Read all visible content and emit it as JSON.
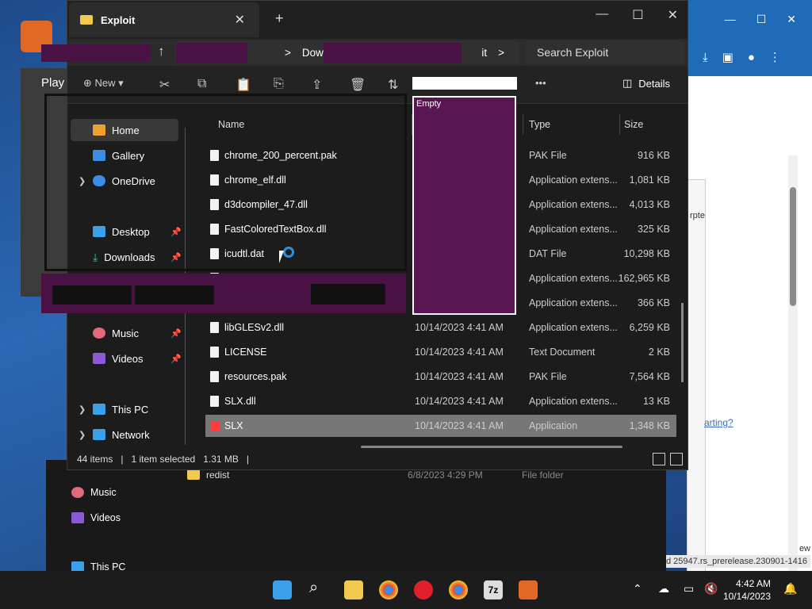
{
  "window": {
    "tab_title": "Exploit",
    "new_tab": "+",
    "minimize": "—",
    "maximize": "☐",
    "close": "✕",
    "tab_close": "✕"
  },
  "nav": {
    "back": "←",
    "forward": "→",
    "up": "↑",
    "address_parts": [
      ">",
      "Downloa",
      "it",
      ">"
    ],
    "search_placeholder": "Search Exploit"
  },
  "toolbar": {
    "new_label": "New",
    "more": "•••",
    "details_label": "Details"
  },
  "sidebar": {
    "items": [
      {
        "label": "Home",
        "active": true
      },
      {
        "label": "Gallery"
      },
      {
        "label": "OneDrive",
        "expandable": true
      },
      {
        "label": "Desktop",
        "pinned": true
      },
      {
        "label": "Downloads",
        "pinned": true
      },
      {
        "label": "Music",
        "pinned": true
      },
      {
        "label": "Videos",
        "pinned": true
      },
      {
        "label": "This PC",
        "expandable": true
      },
      {
        "label": "Network",
        "expandable": true
      }
    ]
  },
  "columns": {
    "name": "Name",
    "type": "Type",
    "size": "Size"
  },
  "files": [
    {
      "name": "chrome_200_percent.pak",
      "date": "",
      "type": "PAK File",
      "size": "916 KB"
    },
    {
      "name": "chrome_elf.dll",
      "date": "",
      "type": "Application extens...",
      "size": "1,081 KB"
    },
    {
      "name": "d3dcompiler_47.dll",
      "date": "",
      "type": "Application extens...",
      "size": "4,013 KB"
    },
    {
      "name": "FastColoredTextBox.dll",
      "date": "",
      "type": "Application extens...",
      "size": "325 KB"
    },
    {
      "name": "icudtl.dat",
      "date": "",
      "type": "DAT File",
      "size": "10,298 KB"
    },
    {
      "name": "",
      "date": "",
      "type": "Application extens...",
      "size": "162,965 KB"
    },
    {
      "name": "",
      "date": "",
      "type": "Application extens...",
      "size": "366 KB"
    },
    {
      "name": "libGLESv2.dll",
      "date": "10/14/2023 4:41 AM",
      "type": "Application extens...",
      "size": "6,259 KB"
    },
    {
      "name": "LICENSE",
      "date": "10/14/2023 4:41 AM",
      "type": "Text Document",
      "size": "2 KB"
    },
    {
      "name": "resources.pak",
      "date": "10/14/2023 4:41 AM",
      "type": "PAK File",
      "size": "7,564 KB"
    },
    {
      "name": "SLX.dll",
      "date": "10/14/2023 4:41 AM",
      "type": "Application extens...",
      "size": "13 KB"
    },
    {
      "name": "SLX",
      "date": "10/14/2023 4:41 AM",
      "type": "Application",
      "size": "1,348 KB",
      "selected": true
    }
  ],
  "status": {
    "items": "44 items",
    "selected": "1 item selected",
    "size": "1.31 MB"
  },
  "popup": {
    "label": "Empty"
  },
  "background_explorer": {
    "items": [
      "Music",
      "Videos",
      "This PC"
    ],
    "row": {
      "name": "redist",
      "date": "6/8/2023 4:29 PM",
      "type": "File folder"
    }
  },
  "background_app": {
    "label": "Play"
  },
  "browser": {
    "link_text": "arting?",
    "side_text": "rpte",
    "footer": "d 25947.rs_prerelease.230901-1416",
    "corner": "ew"
  },
  "taskbar": {
    "time": "4:42 AM",
    "date": "10/14/2023"
  }
}
